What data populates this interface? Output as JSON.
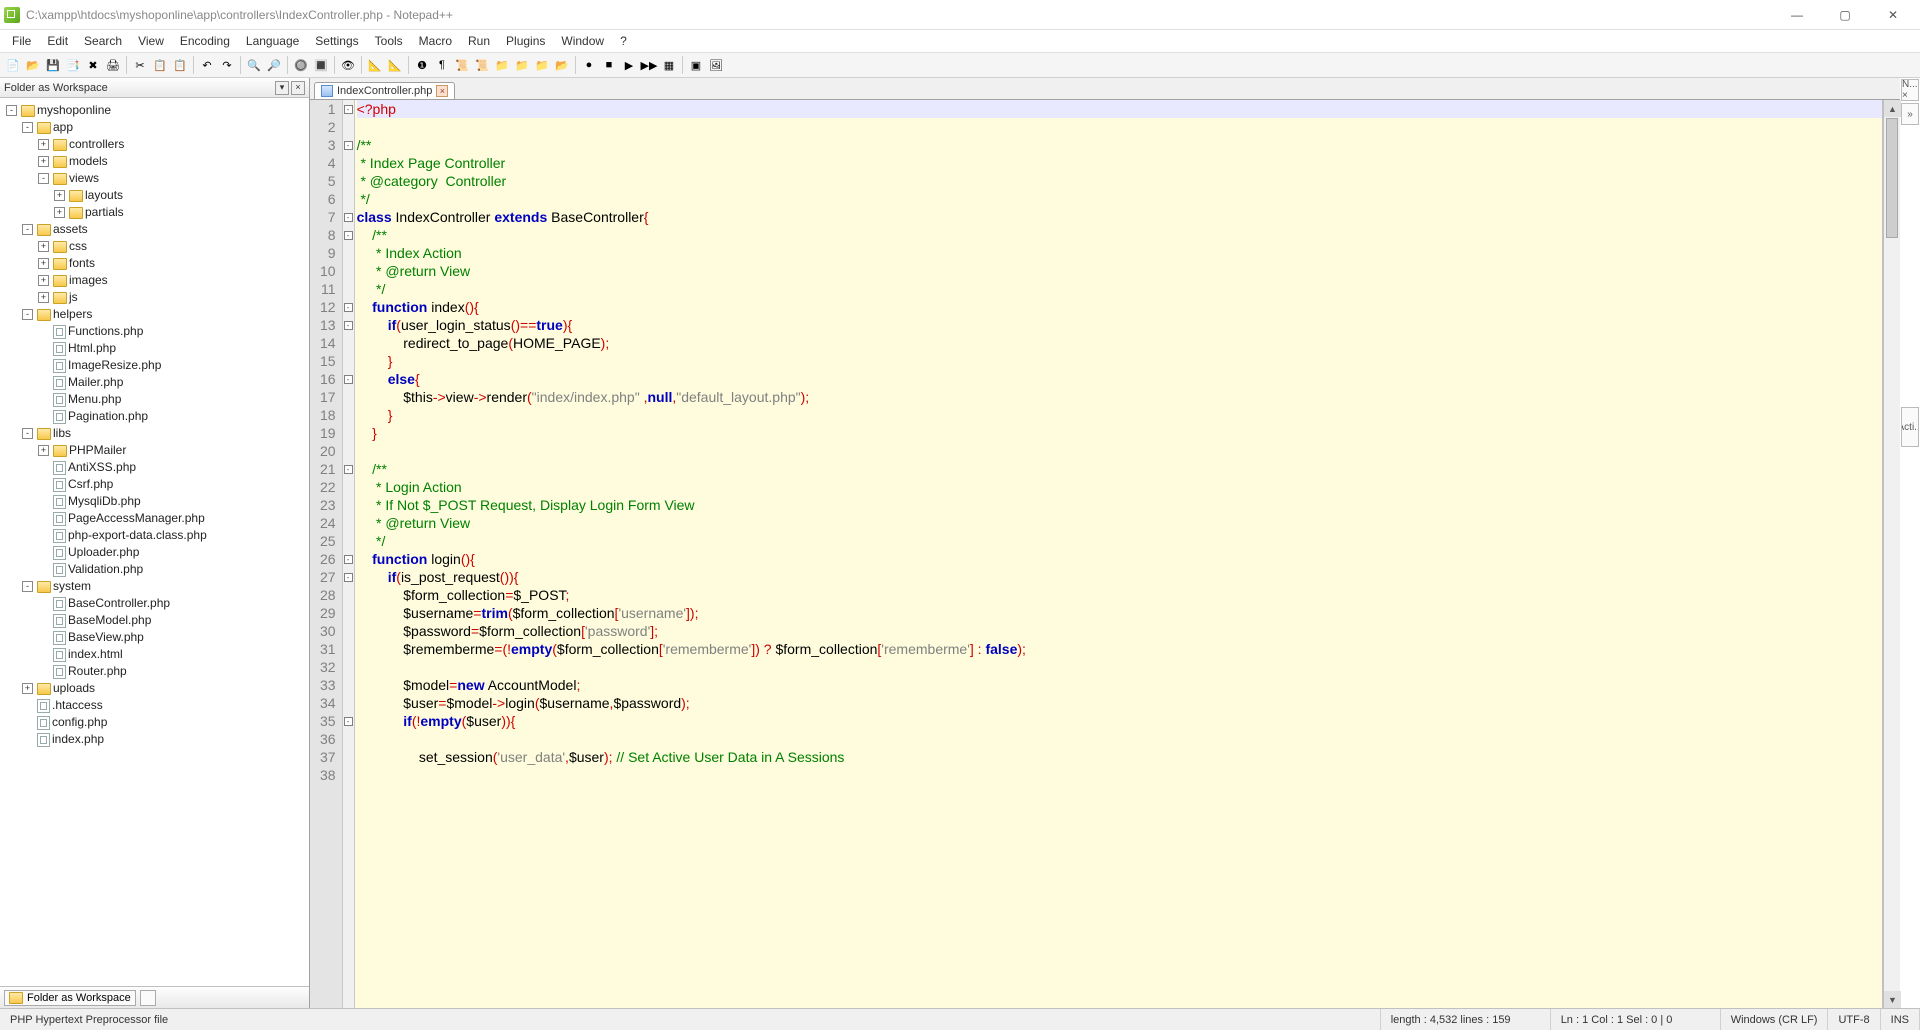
{
  "title": "C:\\xampp\\htdocs\\myshoponline\\app\\controllers\\IndexController.php - Notepad++",
  "menus": [
    "File",
    "Edit",
    "Search",
    "View",
    "Encoding",
    "Language",
    "Settings",
    "Tools",
    "Macro",
    "Run",
    "Plugins",
    "Window",
    "?"
  ],
  "folder_panel": {
    "title": "Folder as Workspace",
    "bottom_tab": "Folder as Workspace"
  },
  "tree": {
    "root": "myshoponline",
    "nodes": [
      {
        "label": "app",
        "lvl": 1,
        "folder": true,
        "tw": "-"
      },
      {
        "label": "controllers",
        "lvl": 2,
        "folder": true,
        "tw": "+"
      },
      {
        "label": "models",
        "lvl": 2,
        "folder": true,
        "tw": "+"
      },
      {
        "label": "views",
        "lvl": 2,
        "folder": true,
        "tw": "-"
      },
      {
        "label": "layouts",
        "lvl": 3,
        "folder": true,
        "tw": "+"
      },
      {
        "label": "partials",
        "lvl": 3,
        "folder": true,
        "tw": "+"
      },
      {
        "label": "assets",
        "lvl": 1,
        "folder": true,
        "tw": "-"
      },
      {
        "label": "css",
        "lvl": 2,
        "folder": true,
        "tw": "+"
      },
      {
        "label": "fonts",
        "lvl": 2,
        "folder": true,
        "tw": "+"
      },
      {
        "label": "images",
        "lvl": 2,
        "folder": true,
        "tw": "+"
      },
      {
        "label": "js",
        "lvl": 2,
        "folder": true,
        "tw": "+"
      },
      {
        "label": "helpers",
        "lvl": 1,
        "folder": true,
        "tw": "-"
      },
      {
        "label": "Functions.php",
        "lvl": 2,
        "folder": false
      },
      {
        "label": "Html.php",
        "lvl": 2,
        "folder": false
      },
      {
        "label": "ImageResize.php",
        "lvl": 2,
        "folder": false
      },
      {
        "label": "Mailer.php",
        "lvl": 2,
        "folder": false
      },
      {
        "label": "Menu.php",
        "lvl": 2,
        "folder": false
      },
      {
        "label": "Pagination.php",
        "lvl": 2,
        "folder": false
      },
      {
        "label": "libs",
        "lvl": 1,
        "folder": true,
        "tw": "-"
      },
      {
        "label": "PHPMailer",
        "lvl": 2,
        "folder": true,
        "tw": "+"
      },
      {
        "label": "AntiXSS.php",
        "lvl": 2,
        "folder": false
      },
      {
        "label": "Csrf.php",
        "lvl": 2,
        "folder": false
      },
      {
        "label": "MysqliDb.php",
        "lvl": 2,
        "folder": false
      },
      {
        "label": "PageAccessManager.php",
        "lvl": 2,
        "folder": false
      },
      {
        "label": "php-export-data.class.php",
        "lvl": 2,
        "folder": false
      },
      {
        "label": "Uploader.php",
        "lvl": 2,
        "folder": false
      },
      {
        "label": "Validation.php",
        "lvl": 2,
        "folder": false
      },
      {
        "label": "system",
        "lvl": 1,
        "folder": true,
        "tw": "-"
      },
      {
        "label": "BaseController.php",
        "lvl": 2,
        "folder": false
      },
      {
        "label": "BaseModel.php",
        "lvl": 2,
        "folder": false
      },
      {
        "label": "BaseView.php",
        "lvl": 2,
        "folder": false
      },
      {
        "label": "index.html",
        "lvl": 2,
        "folder": false
      },
      {
        "label": "Router.php",
        "lvl": 2,
        "folder": false
      },
      {
        "label": "uploads",
        "lvl": 1,
        "folder": true,
        "tw": "+"
      },
      {
        "label": ".htaccess",
        "lvl": 1,
        "folder": false
      },
      {
        "label": "config.php",
        "lvl": 1,
        "folder": false
      },
      {
        "label": "index.php",
        "lvl": 1,
        "folder": false
      }
    ]
  },
  "tab": {
    "label": "IndexController.php"
  },
  "rightdock": {
    "top": "N... ×",
    "chev": "»",
    "acti": "Acti..."
  },
  "code_lines": [
    {
      "n": 1,
      "fold": "-",
      "hl": true,
      "segs": [
        [
          "<?php",
          "k-red"
        ]
      ]
    },
    {
      "n": 2,
      "segs": []
    },
    {
      "n": 3,
      "fold": "-",
      "segs": [
        [
          "/**",
          "k-green"
        ]
      ]
    },
    {
      "n": 4,
      "segs": [
        [
          " * Index Page Controller",
          "k-green"
        ]
      ]
    },
    {
      "n": 5,
      "segs": [
        [
          " * @category  Controller",
          "k-green"
        ]
      ]
    },
    {
      "n": 6,
      "segs": [
        [
          " */",
          "k-green"
        ]
      ]
    },
    {
      "n": 7,
      "fold": "-",
      "segs": [
        [
          "class",
          "k-blue"
        ],
        [
          " IndexController ",
          "k-black"
        ],
        [
          "extends",
          "k-blue"
        ],
        [
          " BaseController",
          "k-black"
        ],
        [
          "{",
          "k-red"
        ]
      ]
    },
    {
      "n": 8,
      "fold": "-",
      "segs": [
        [
          "    /**",
          "k-green"
        ]
      ]
    },
    {
      "n": 9,
      "segs": [
        [
          "     * Index Action",
          "k-green"
        ]
      ]
    },
    {
      "n": 10,
      "segs": [
        [
          "     * @return View",
          "k-green"
        ]
      ]
    },
    {
      "n": 11,
      "segs": [
        [
          "     */",
          "k-green"
        ]
      ]
    },
    {
      "n": 12,
      "fold": "-",
      "segs": [
        [
          "    ",
          "k-black"
        ],
        [
          "function",
          "k-blue"
        ],
        [
          " index",
          "k-black"
        ],
        [
          "(){",
          "k-red"
        ]
      ]
    },
    {
      "n": 13,
      "fold": "-",
      "segs": [
        [
          "        ",
          "k-black"
        ],
        [
          "if",
          "k-blue"
        ],
        [
          "(",
          "k-red"
        ],
        [
          "user_login_status",
          "k-black"
        ],
        [
          "()==",
          "k-red"
        ],
        [
          "true",
          "k-blue"
        ],
        [
          "){",
          "k-red"
        ]
      ]
    },
    {
      "n": 14,
      "segs": [
        [
          "            redirect_to_page",
          "k-black"
        ],
        [
          "(",
          "k-red"
        ],
        [
          "HOME_PAGE",
          "k-black"
        ],
        [
          ");",
          "k-red"
        ]
      ]
    },
    {
      "n": 15,
      "segs": [
        [
          "        ",
          "k-black"
        ],
        [
          "}",
          "k-red"
        ]
      ]
    },
    {
      "n": 16,
      "fold": "-",
      "segs": [
        [
          "        ",
          "k-black"
        ],
        [
          "else",
          "k-blue"
        ],
        [
          "{",
          "k-red"
        ]
      ]
    },
    {
      "n": 17,
      "segs": [
        [
          "            $this",
          "k-black"
        ],
        [
          "->",
          "k-red"
        ],
        [
          "view",
          "k-black"
        ],
        [
          "->",
          "k-red"
        ],
        [
          "render",
          "k-black"
        ],
        [
          "(",
          "k-red"
        ],
        [
          "\"index/index.php\"",
          "k-gray"
        ],
        [
          " ,",
          "k-red"
        ],
        [
          "null",
          "k-blue"
        ],
        [
          ",",
          "k-red"
        ],
        [
          "\"default_layout.php\"",
          "k-gray"
        ],
        [
          ");",
          "k-red"
        ]
      ]
    },
    {
      "n": 18,
      "segs": [
        [
          "        ",
          "k-black"
        ],
        [
          "}",
          "k-red"
        ]
      ]
    },
    {
      "n": 19,
      "segs": [
        [
          "    ",
          "k-black"
        ],
        [
          "}",
          "k-red"
        ]
      ]
    },
    {
      "n": 20,
      "segs": []
    },
    {
      "n": 21,
      "fold": "-",
      "segs": [
        [
          "    /**",
          "k-green"
        ]
      ]
    },
    {
      "n": 22,
      "segs": [
        [
          "     * Login Action",
          "k-green"
        ]
      ]
    },
    {
      "n": 23,
      "segs": [
        [
          "     * If Not $_POST Request, Display Login Form View",
          "k-green"
        ]
      ]
    },
    {
      "n": 24,
      "segs": [
        [
          "     * @return View",
          "k-green"
        ]
      ]
    },
    {
      "n": 25,
      "segs": [
        [
          "     */",
          "k-green"
        ]
      ]
    },
    {
      "n": 26,
      "fold": "-",
      "segs": [
        [
          "    ",
          "k-black"
        ],
        [
          "function",
          "k-blue"
        ],
        [
          " login",
          "k-black"
        ],
        [
          "(){",
          "k-red"
        ]
      ]
    },
    {
      "n": 27,
      "fold": "-",
      "segs": [
        [
          "        ",
          "k-black"
        ],
        [
          "if",
          "k-blue"
        ],
        [
          "(",
          "k-red"
        ],
        [
          "is_post_request",
          "k-black"
        ],
        [
          "()){",
          "k-red"
        ]
      ]
    },
    {
      "n": 28,
      "segs": [
        [
          "            $form_collection",
          "k-black"
        ],
        [
          "=",
          "k-red"
        ],
        [
          "$_POST",
          "k-black"
        ],
        [
          ";",
          "k-red"
        ]
      ]
    },
    {
      "n": 29,
      "segs": [
        [
          "            $username",
          "k-black"
        ],
        [
          "=",
          "k-red"
        ],
        [
          "trim",
          "k-blue"
        ],
        [
          "(",
          "k-red"
        ],
        [
          "$form_collection",
          "k-black"
        ],
        [
          "[",
          "k-red"
        ],
        [
          "'username'",
          "k-gray"
        ],
        [
          "]);",
          "k-red"
        ]
      ]
    },
    {
      "n": 30,
      "segs": [
        [
          "            $password",
          "k-black"
        ],
        [
          "=",
          "k-red"
        ],
        [
          "$form_collection",
          "k-black"
        ],
        [
          "[",
          "k-red"
        ],
        [
          "'password'",
          "k-gray"
        ],
        [
          "];",
          "k-red"
        ]
      ]
    },
    {
      "n": 31,
      "segs": [
        [
          "            $rememberme",
          "k-black"
        ],
        [
          "=(!",
          "k-red"
        ],
        [
          "empty",
          "k-blue"
        ],
        [
          "(",
          "k-red"
        ],
        [
          "$form_collection",
          "k-black"
        ],
        [
          "[",
          "k-red"
        ],
        [
          "'rememberme'",
          "k-gray"
        ],
        [
          "]) ? ",
          "k-red"
        ],
        [
          "$form_collection",
          "k-black"
        ],
        [
          "[",
          "k-red"
        ],
        [
          "'rememberme'",
          "k-gray"
        ],
        [
          "] : ",
          "k-red"
        ],
        [
          "false",
          "k-blue"
        ],
        [
          ");",
          "k-red"
        ]
      ]
    },
    {
      "n": 32,
      "segs": []
    },
    {
      "n": 33,
      "segs": [
        [
          "            $model",
          "k-black"
        ],
        [
          "=",
          "k-red"
        ],
        [
          "new",
          "k-blue"
        ],
        [
          " AccountModel",
          "k-black"
        ],
        [
          ";",
          "k-red"
        ]
      ]
    },
    {
      "n": 34,
      "segs": [
        [
          "            $user",
          "k-black"
        ],
        [
          "=",
          "k-red"
        ],
        [
          "$model",
          "k-black"
        ],
        [
          "->",
          "k-red"
        ],
        [
          "login",
          "k-black"
        ],
        [
          "(",
          "k-red"
        ],
        [
          "$username",
          "k-black"
        ],
        [
          ",",
          "k-red"
        ],
        [
          "$password",
          "k-black"
        ],
        [
          ");",
          "k-red"
        ]
      ]
    },
    {
      "n": 35,
      "fold": "-",
      "segs": [
        [
          "            ",
          "k-black"
        ],
        [
          "if",
          "k-blue"
        ],
        [
          "(!",
          "k-red"
        ],
        [
          "empty",
          "k-blue"
        ],
        [
          "(",
          "k-red"
        ],
        [
          "$user",
          "k-black"
        ],
        [
          ")){",
          "k-red"
        ]
      ]
    },
    {
      "n": 36,
      "segs": []
    },
    {
      "n": 37,
      "segs": [
        [
          "                set_session",
          "k-black"
        ],
        [
          "(",
          "k-red"
        ],
        [
          "'user_data'",
          "k-gray"
        ],
        [
          ",",
          "k-red"
        ],
        [
          "$user",
          "k-black"
        ],
        [
          "); ",
          "k-red"
        ],
        [
          "// Set Active User Data in A Sessions",
          "k-green"
        ]
      ]
    },
    {
      "n": 38,
      "segs": []
    }
  ],
  "status": {
    "lang": "PHP Hypertext Preprocessor file",
    "length": "length : 4,532    lines : 159",
    "pos": "Ln : 1    Col : 1    Sel : 0 | 0",
    "eol": "Windows (CR LF)",
    "enc": "UTF-8",
    "ins": "INS"
  }
}
